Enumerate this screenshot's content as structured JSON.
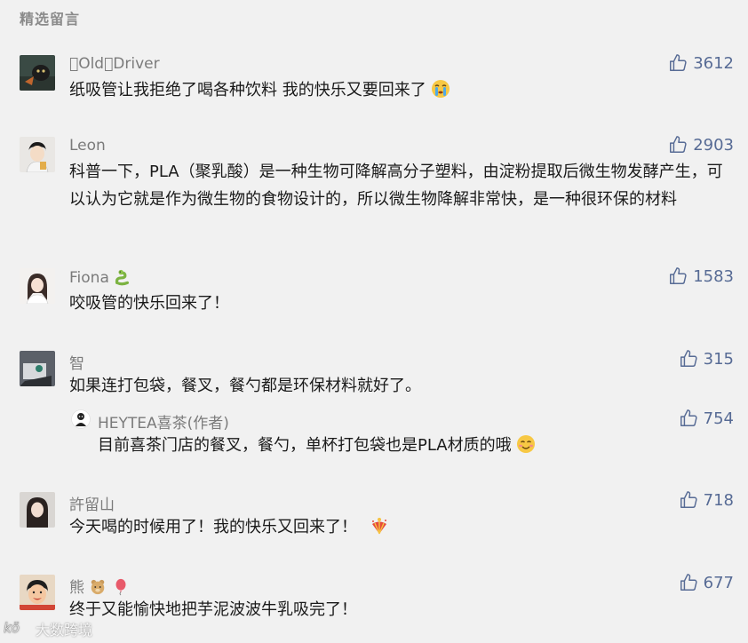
{
  "section_title": "精选留言",
  "comments": [
    {
      "name": "\u0000Old\u0000Driver",
      "text": "纸吸管让我拒绝了喝各种饮料 我的快乐又要回来了",
      "likes": "3612",
      "emoji": "crying-face"
    },
    {
      "name": "Leon",
      "text": "科普一下，PLA（聚乳酸）是一种生物可降解高分子塑料，由淀粉提取后微生物发酵产生，可以认为它就是作为微生物的食物设计的，所以微生物降解非常快，是一种很环保的材料",
      "likes": "2903"
    },
    {
      "name": "Fiona",
      "name_emoji": "snake",
      "text": "咬吸管的快乐回来了！",
      "likes": "1583"
    },
    {
      "name": "智",
      "text": "如果连打包袋，餐叉，餐勺都是环保材料就好了。",
      "likes": "315",
      "reply": {
        "name": "HEYTEA喜茶(作者)",
        "text": "目前喜茶门店的餐叉，餐勺，单杯打包袋也是PLA材质的哦",
        "likes": "754",
        "emoji": "smiling-face"
      }
    },
    {
      "name": "許留山",
      "text": "今天喝的时候用了！我的快乐又回来了！",
      "likes": "718",
      "emoji": "firecracker"
    },
    {
      "name": "熊",
      "name_emoji": "bear-balloon",
      "text": "终于又能愉快地把芋泥波波牛乳吸完了！",
      "likes": "677"
    }
  ],
  "watermark": "大数跨境",
  "colors": {
    "background": "#f1f1f1",
    "likes": "#576b95",
    "name": "#7b7b7b",
    "text": "#1a1a1a"
  }
}
